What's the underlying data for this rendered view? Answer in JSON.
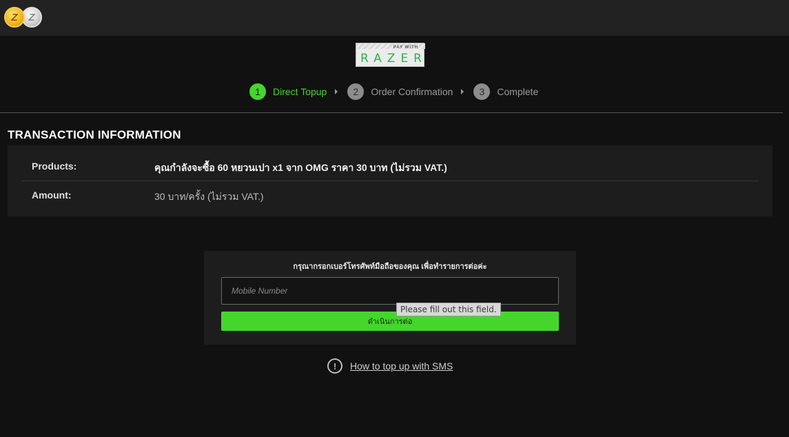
{
  "header": {
    "coins": [
      {
        "icon": "zgold-coin-icon",
        "letter": "Z",
        "color": "#f2b21c"
      },
      {
        "icon": "zsilver-coin-icon",
        "letter": "Z",
        "color": "#cfcfcf"
      }
    ]
  },
  "logo": {
    "pay_with": "PAY WITH",
    "brand": "RAZER"
  },
  "steps": [
    {
      "number": "1",
      "label": "Direct Topup",
      "active": true
    },
    {
      "number": "2",
      "label": "Order Confirmation",
      "active": false
    },
    {
      "number": "3",
      "label": "Complete",
      "active": false
    }
  ],
  "transaction": {
    "title": "TRANSACTION INFORMATION",
    "products_label": "Products:",
    "products_value": "คุณกำลังจะซื้อ 60 หยวนเปา x1 จาก OMG ราคา 30 บาท (ไม่รวม VAT.)",
    "amount_label": "Amount:",
    "amount_value": "30 บาท/ครั้ง (ไม่รวม VAT.)"
  },
  "form": {
    "heading": "กรุณากรอกเบอร์โทรศัพท์มือถือของคุณ เพื่อทำรายการต่อค่ะ",
    "mobile_placeholder": "Mobile Number",
    "mobile_value": "",
    "proceed_label": "ดำเนินการต่อ",
    "validation_tooltip": "Please fill out this field."
  },
  "help": {
    "icon": "exclamation-circle-icon",
    "link_text": "How to top up with SMS"
  },
  "colors": {
    "accent": "#44d62c",
    "background": "#111111",
    "panel": "#1d1d1d",
    "topbar": "#222222"
  }
}
